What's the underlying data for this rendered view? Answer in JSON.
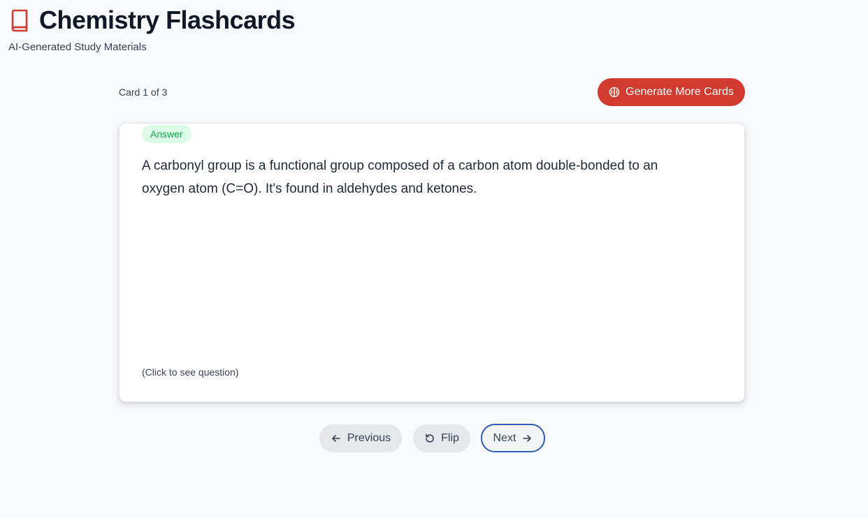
{
  "header": {
    "title": "Chemistry Flashcards",
    "subtitle": "AI-Generated Study Materials",
    "icon": "book-icon"
  },
  "toolbar": {
    "card_counter": "Card 1 of 3",
    "generate_label": "Generate More Cards",
    "generate_icon": "brain-icon",
    "accent_color": "#d13a2e"
  },
  "card": {
    "side_badge": "Answer",
    "text": "A carbonyl group is a functional group composed of a carbon atom double-bonded to an oxygen atom (C=O). It's found in aldehydes and ketones.",
    "hint": "(Click to see question)"
  },
  "navigation": {
    "previous_label": "Previous",
    "flip_label": "Flip",
    "next_label": "Next"
  }
}
